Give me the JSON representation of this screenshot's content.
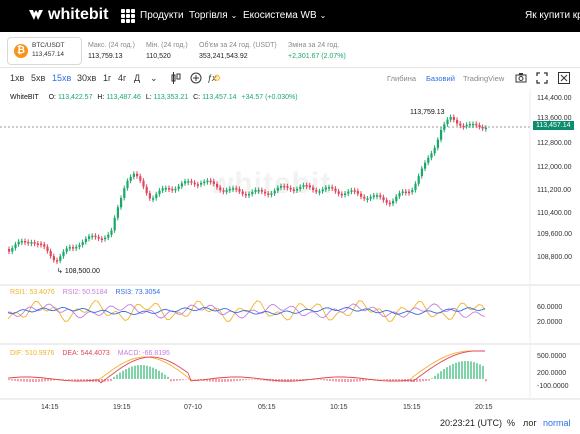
{
  "nav": {
    "logo": "whitebit",
    "items": [
      {
        "label": "Продукти",
        "caret": false
      },
      {
        "label": "Торгівля",
        "caret": true
      },
      {
        "label": "Екосистема WB",
        "caret": true
      }
    ],
    "buy_crypto": "Як купити крип"
  },
  "ticker": {
    "pair": "BTC/USDT",
    "price": "113,457.14",
    "stats": [
      {
        "label": "Макс. (24 год.)",
        "value": "113,759.13",
        "green": false
      },
      {
        "label": "Мін. (24 год.)",
        "value": "110,520",
        "green": false
      },
      {
        "label": "Об'єм за 24 год. (USDT)",
        "value": "353,241,543.92",
        "green": false
      },
      {
        "label": "Зміна за 24 год.",
        "value": "+2,301.67 (2.07%)",
        "green": true
      }
    ]
  },
  "toolbar": {
    "intervals": [
      "1хв",
      "5хв",
      "15хв",
      "30хв",
      "1г",
      "4г",
      "Д"
    ],
    "active_interval": "15хв",
    "views": [
      "Глибина",
      "Базовий",
      "TradingView"
    ],
    "active_view": "Базовий",
    "icons": [
      "chevron-down-icon",
      "candles-icon",
      "compare-icon",
      "function-icon",
      "settings-icon",
      "camera-icon",
      "expand-icon",
      "close-icon"
    ]
  },
  "legend": {
    "exchange": "WhiteBIT",
    "o_label": "O:",
    "o_value": "113,422.57",
    "h_label": "H:",
    "h_value": "113,487.46",
    "l_label": "L:",
    "l_value": "113,353.21",
    "c_label": "C:",
    "c_value": "113,457.14",
    "change": "+34.57 (+0.030%)"
  },
  "annotations": {
    "high": "113,759.13",
    "low": "108,500.00"
  },
  "price_axis": [
    "114,400.00",
    "113,600.00",
    "112,800.00",
    "112,000.00",
    "111,200.00",
    "110,400.00",
    "109,600.00",
    "108,800.00"
  ],
  "last_price_tag": "113,457.14",
  "rsi": {
    "rsi1": "RSI1: 53.4076",
    "rsi2": "RSI2: 50.5184",
    "rsi3": "RSI3: 73.3054",
    "axis": [
      "60.0000",
      "20.0000"
    ]
  },
  "macd": {
    "dif": "DIF: 510.9976",
    "dea": "DEA: 544.4073",
    "macd": "MACD: -66.8195",
    "axis": [
      "500.0000",
      "200.0000",
      "-100.0000"
    ]
  },
  "time_axis": [
    "14:15",
    "19:15",
    "07-10",
    "05:15",
    "10:15",
    "15:15",
    "20:15"
  ],
  "footer": {
    "time": "20:23:21 (UTC)",
    "percent": "%",
    "log": "лог",
    "normal": "normal"
  },
  "colors": {
    "up": "#1aa86a",
    "down": "#e0455a",
    "rsi1": "#f0b429",
    "rsi2": "#c77ddf",
    "rsi3": "#2f6fe4",
    "dif": "#f0b429",
    "dea": "#e0455a"
  }
}
